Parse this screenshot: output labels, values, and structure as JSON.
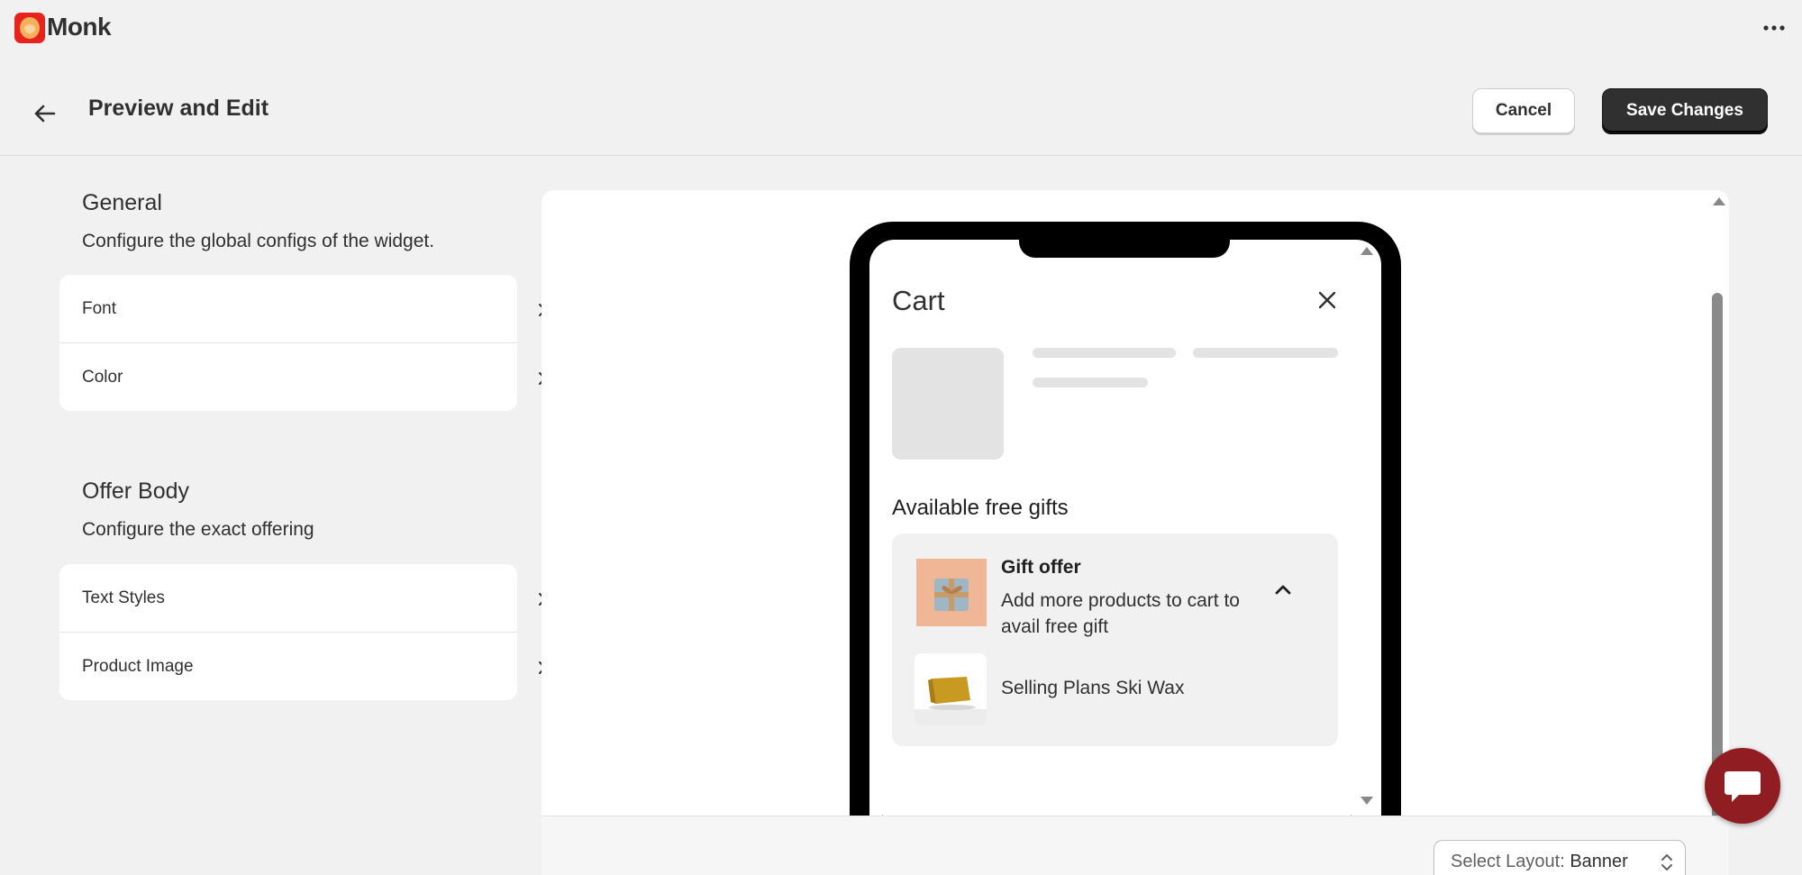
{
  "app": {
    "name": "Monk",
    "logo_icon": "monk-logo-icon",
    "more_icon": "more-horizontal-icon"
  },
  "header": {
    "title": "Preview and Edit",
    "back_icon": "arrow-left-icon",
    "cancel_label": "Cancel",
    "save_label": "Save Changes"
  },
  "sidebar": {
    "general": {
      "title": "General",
      "description": "Configure the global configs of the widget.",
      "items": [
        {
          "label": "Font"
        },
        {
          "label": "Color"
        }
      ]
    },
    "offer_body": {
      "title": "Offer Body",
      "description": "Configure the exact offering",
      "items": [
        {
          "label": "Text Styles"
        },
        {
          "label": "Product Image"
        }
      ]
    }
  },
  "preview": {
    "cart_title": "Cart",
    "close_icon": "close-icon",
    "gifts_title": "Available free gifts",
    "gift": {
      "name": "Gift offer",
      "description": "Add more products to cart to avail free gift",
      "collapse_icon": "chevron-up-icon"
    },
    "product": {
      "name": "Selling Plans Ski Wax"
    }
  },
  "footer": {
    "select_label": "Select Layout:",
    "select_value": "Banner"
  },
  "colors": {
    "accent": "#303030",
    "chat_button": "#8f1d22",
    "logo_bg": "#e8231d"
  },
  "chat": {
    "icon": "chat-bubble-icon"
  }
}
